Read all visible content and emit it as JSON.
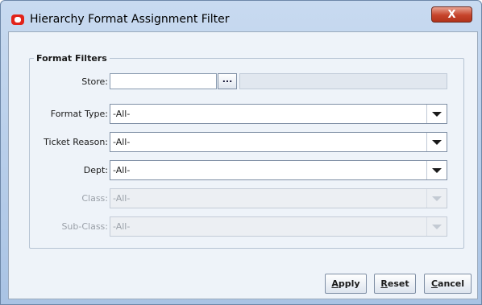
{
  "window": {
    "title": "Hierarchy Format Assignment Filter",
    "close_label": "X",
    "icon": "oracle-logo-icon"
  },
  "filters": {
    "group_title": "Format Filters",
    "store": {
      "label": "Store:",
      "value": "",
      "browse_label": "..."
    },
    "format_type": {
      "label": "Format Type:",
      "value": "-All-",
      "enabled": true
    },
    "ticket_reason": {
      "label": "Ticket Reason:",
      "value": "-All-",
      "enabled": true
    },
    "dept": {
      "label": "Dept:",
      "value": "-All-",
      "enabled": true
    },
    "class": {
      "label": "Class:",
      "value": "-All-",
      "enabled": false
    },
    "sub_class": {
      "label": "Sub-Class:",
      "value": "-All-",
      "enabled": false
    }
  },
  "buttons": {
    "apply": {
      "first": "A",
      "rest": "pply"
    },
    "reset": {
      "first": "R",
      "rest": "eset"
    },
    "cancel": {
      "first": "C",
      "rest": "ancel"
    }
  },
  "colors": {
    "accent": "#e2231a",
    "titlebar": "#b8cfea",
    "client": "#eef3f9",
    "close": "#c6442b"
  }
}
